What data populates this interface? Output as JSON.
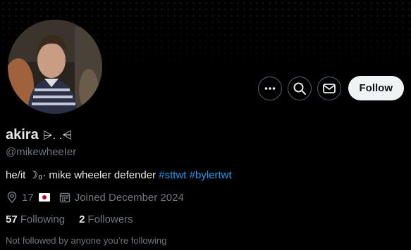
{
  "profile": {
    "display_name": "akira",
    "name_emoji": "⩥. .⩤",
    "handle": "@mikewheeIer",
    "bio_text": "he/it ☽₀· mike wheeler defender ",
    "bio_tags": [
      "#sttwt",
      "#bylertwt"
    ],
    "location": "17",
    "location_flag_icon": "japan-flag-icon",
    "joined": "Joined December 2024",
    "following_count": "57",
    "following_label": "Following",
    "followers_count": "2",
    "followers_label": "Followers",
    "follow_note": "Not followed by anyone you’re following"
  },
  "actions": {
    "more_icon": "more-icon",
    "search_icon": "search-icon",
    "message_icon": "mail-icon",
    "follow_label": "Follow"
  },
  "colors": {
    "accent": "#1d9bf0",
    "background": "#000000",
    "secondary_text": "#71767b"
  }
}
